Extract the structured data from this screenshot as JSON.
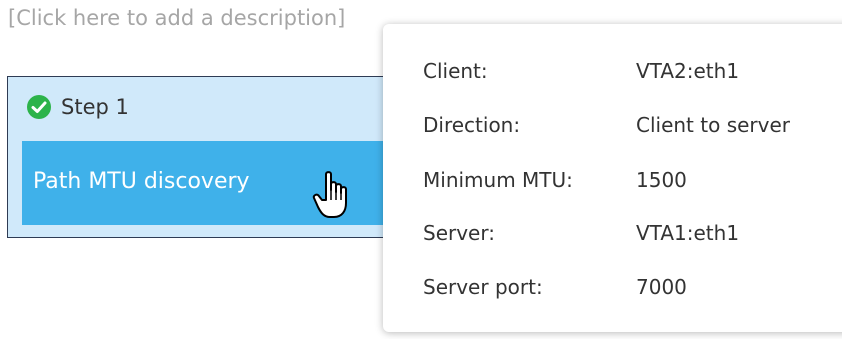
{
  "description_placeholder": "[Click here to add a description]",
  "step": {
    "title": "Step 1",
    "status_icon": "check-circle-icon",
    "action_label": "Path MTU discovery"
  },
  "tooltip": {
    "rows": [
      {
        "key": "Client:",
        "value": "VTA2:eth1"
      },
      {
        "key": "Direction:",
        "value": "Client to server"
      },
      {
        "key": "Minimum MTU:",
        "value": "1500"
      },
      {
        "key": "Server:",
        "value": "VTA1:eth1"
      },
      {
        "key": "Server port:",
        "value": "7000"
      }
    ]
  },
  "colors": {
    "card_background": "#d0e9fa",
    "action_background": "#3fb1ea",
    "success_green": "#2cb34a",
    "card_border": "#2e3b54"
  },
  "cursor_icon": "hand-pointer-icon"
}
